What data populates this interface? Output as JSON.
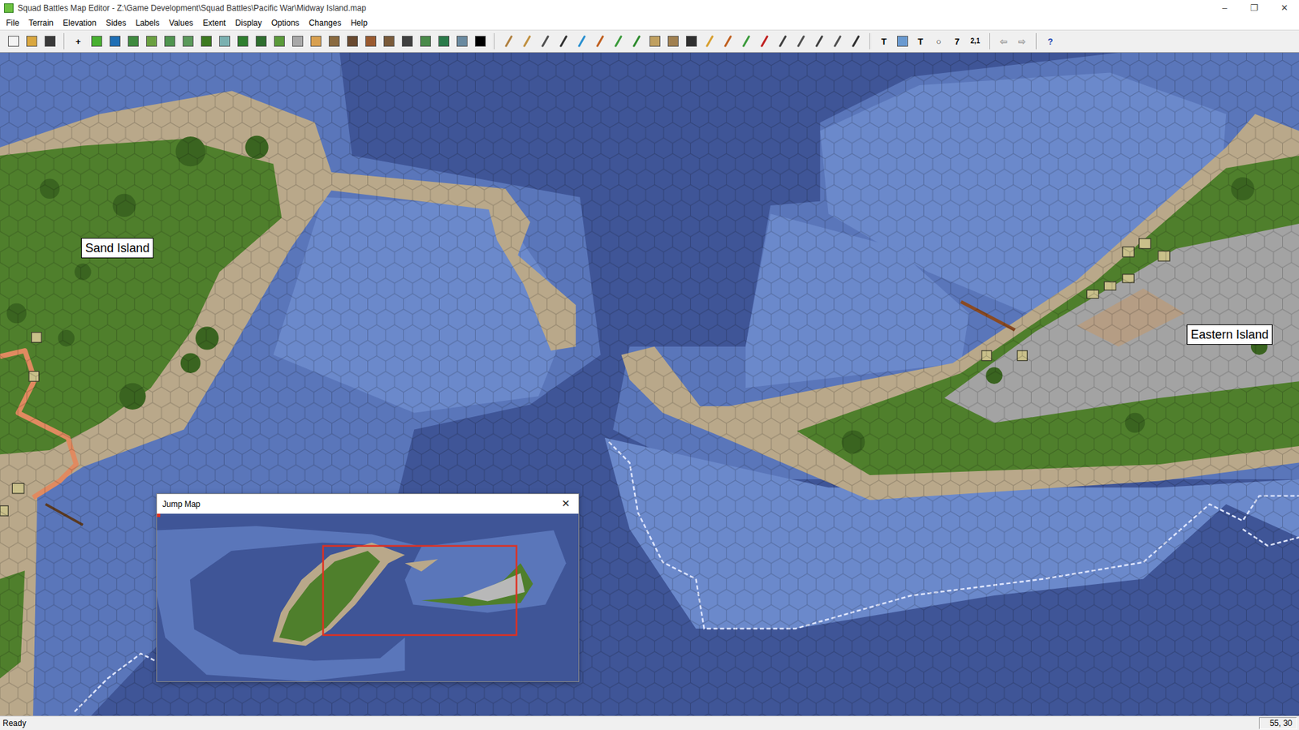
{
  "window": {
    "title": "Squad Battles Map Editor - Z:\\Game Development\\Squad Battles\\Pacific War\\Midway Island.map",
    "controls": [
      "–",
      "❐",
      "✕"
    ]
  },
  "menu": [
    "File",
    "Terrain",
    "Elevation",
    "Sides",
    "Labels",
    "Values",
    "Extent",
    "Display",
    "Options",
    "Changes",
    "Help"
  ],
  "toolbar": [
    {
      "kind": "tile",
      "color": "#f4f4f4",
      "disabled": false
    },
    {
      "kind": "tile",
      "color": "#d9a740",
      "disabled": false
    },
    {
      "kind": "tile",
      "color": "#3a3a3a",
      "disabled": false
    },
    {
      "kind": "sep"
    },
    {
      "kind": "text",
      "label": "+",
      "color": "#000000",
      "disabled": false
    },
    {
      "kind": "tile",
      "color": "#48b030",
      "disabled": false
    },
    {
      "kind": "tile",
      "color": "#1f6fb5",
      "disabled": false
    },
    {
      "kind": "tile",
      "color": "#3f8a3f",
      "disabled": false
    },
    {
      "kind": "tile",
      "color": "#6aa040",
      "disabled": false
    },
    {
      "kind": "tile",
      "color": "#4f944f",
      "disabled": false
    },
    {
      "kind": "tile",
      "color": "#5b9a5b",
      "disabled": false
    },
    {
      "kind": "tile",
      "color": "#3c7a20",
      "disabled": false
    },
    {
      "kind": "tile",
      "color": "#7ab0b0",
      "disabled": false
    },
    {
      "kind": "tile",
      "color": "#2f7f2f",
      "disabled": false
    },
    {
      "kind": "tile",
      "color": "#2f6f2f",
      "disabled": false
    },
    {
      "kind": "tile",
      "color": "#5a9a3a",
      "disabled": false
    },
    {
      "kind": "tile",
      "color": "#a8a8a8",
      "disabled": false
    },
    {
      "kind": "tile",
      "color": "#d8a050",
      "disabled": false
    },
    {
      "kind": "tile",
      "color": "#8a6a40",
      "disabled": false
    },
    {
      "kind": "tile",
      "color": "#6a4a30",
      "disabled": false
    },
    {
      "kind": "tile",
      "color": "#9a5a30",
      "disabled": false
    },
    {
      "kind": "tile",
      "color": "#7a5a3a",
      "disabled": false
    },
    {
      "kind": "tile",
      "color": "#404040",
      "disabled": false
    },
    {
      "kind": "tile",
      "color": "#4a8a4a",
      "disabled": false
    },
    {
      "kind": "tile",
      "color": "#2a7a4a",
      "disabled": false
    },
    {
      "kind": "tile",
      "color": "#6a8aa0",
      "disabled": false
    },
    {
      "kind": "tile",
      "color": "#000000",
      "disabled": false
    },
    {
      "kind": "sep"
    },
    {
      "kind": "line",
      "color": "#b08040",
      "disabled": false
    },
    {
      "kind": "line",
      "color": "#c09040",
      "disabled": false
    },
    {
      "kind": "line",
      "color": "#505050",
      "disabled": false
    },
    {
      "kind": "line",
      "color": "#303030",
      "disabled": false
    },
    {
      "kind": "line",
      "color": "#2a90d0",
      "disabled": false
    },
    {
      "kind": "line",
      "color": "#c06020",
      "disabled": false
    },
    {
      "kind": "line",
      "color": "#3a9a3a",
      "disabled": false
    },
    {
      "kind": "line",
      "color": "#2e8b2e",
      "disabled": false
    },
    {
      "kind": "tile",
      "color": "#c0a060",
      "disabled": false
    },
    {
      "kind": "tile",
      "color": "#a08050",
      "disabled": false
    },
    {
      "kind": "tile",
      "color": "#303030",
      "disabled": false
    },
    {
      "kind": "line",
      "color": "#d8a030",
      "disabled": false
    },
    {
      "kind": "line",
      "color": "#c06020",
      "disabled": false
    },
    {
      "kind": "line",
      "color": "#3a9a3a",
      "disabled": false
    },
    {
      "kind": "line",
      "color": "#c02020",
      "disabled": false
    },
    {
      "kind": "line",
      "color": "#404040",
      "disabled": false
    },
    {
      "kind": "line",
      "color": "#505050",
      "disabled": false
    },
    {
      "kind": "line",
      "color": "#404040",
      "disabled": false
    },
    {
      "kind": "line",
      "color": "#505050",
      "disabled": false
    },
    {
      "kind": "line",
      "color": "#303030",
      "disabled": false
    },
    {
      "kind": "sep"
    },
    {
      "kind": "text",
      "label": "T",
      "color": "#000000",
      "disabled": false
    },
    {
      "kind": "tile",
      "color": "#6a9ad0",
      "disabled": false
    },
    {
      "kind": "text",
      "label": "T",
      "color": "#000000",
      "disabled": false
    },
    {
      "kind": "text",
      "label": "○",
      "color": "#000000",
      "disabled": false
    },
    {
      "kind": "text",
      "label": "7",
      "color": "#000000",
      "disabled": false
    },
    {
      "kind": "text",
      "label": "2,1",
      "color": "#000000",
      "disabled": false
    },
    {
      "kind": "sep"
    },
    {
      "kind": "text",
      "label": "⇦",
      "color": "#000000",
      "disabled": true
    },
    {
      "kind": "text",
      "label": "⇨",
      "color": "#000000",
      "disabled": true
    },
    {
      "kind": "sep"
    },
    {
      "kind": "text",
      "label": "?",
      "color": "#1a3fb0",
      "disabled": false
    }
  ],
  "map": {
    "labels": [
      "Sand Island",
      "Eastern Island"
    ]
  },
  "jump_map": {
    "title": "Jump Map",
    "close": "✕"
  },
  "status_bar": {
    "message": "Ready",
    "coords": "55, 30"
  }
}
